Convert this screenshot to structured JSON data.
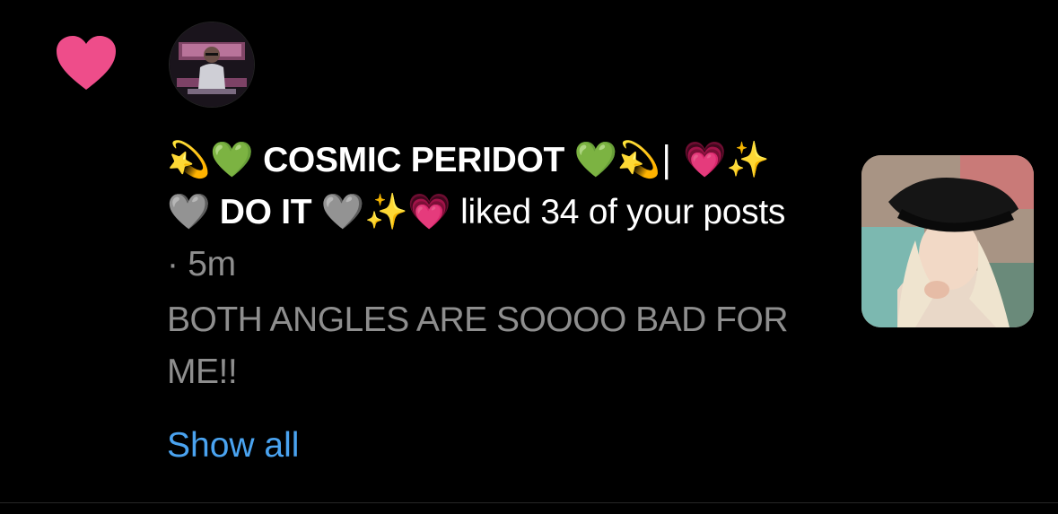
{
  "notification": {
    "type_icon": "heart-icon",
    "type_color": "#ee4d8a",
    "avatar_icon": "user-avatar",
    "actor_name_prefix": "💫💚",
    "actor_name_main": " COSMIC PERIDOT ",
    "actor_name_mid": "💚💫| 💗✨🩶",
    "actor_name_second": " DO IT ",
    "actor_name_suffix": "🩶✨💗",
    "action_text": " liked 34 of your posts",
    "separator": " · ",
    "timestamp": "5m",
    "comment_text": "BOTH ANGLES ARE SOOOO BAD FOR ME!!",
    "show_all_label": "Show all",
    "thumbnail_icon": "post-thumbnail"
  },
  "colors": {
    "background": "#000000",
    "text_primary": "#ffffff",
    "text_secondary": "#8e8e8e",
    "link": "#4aa3f0",
    "heart": "#ee4d8a"
  }
}
